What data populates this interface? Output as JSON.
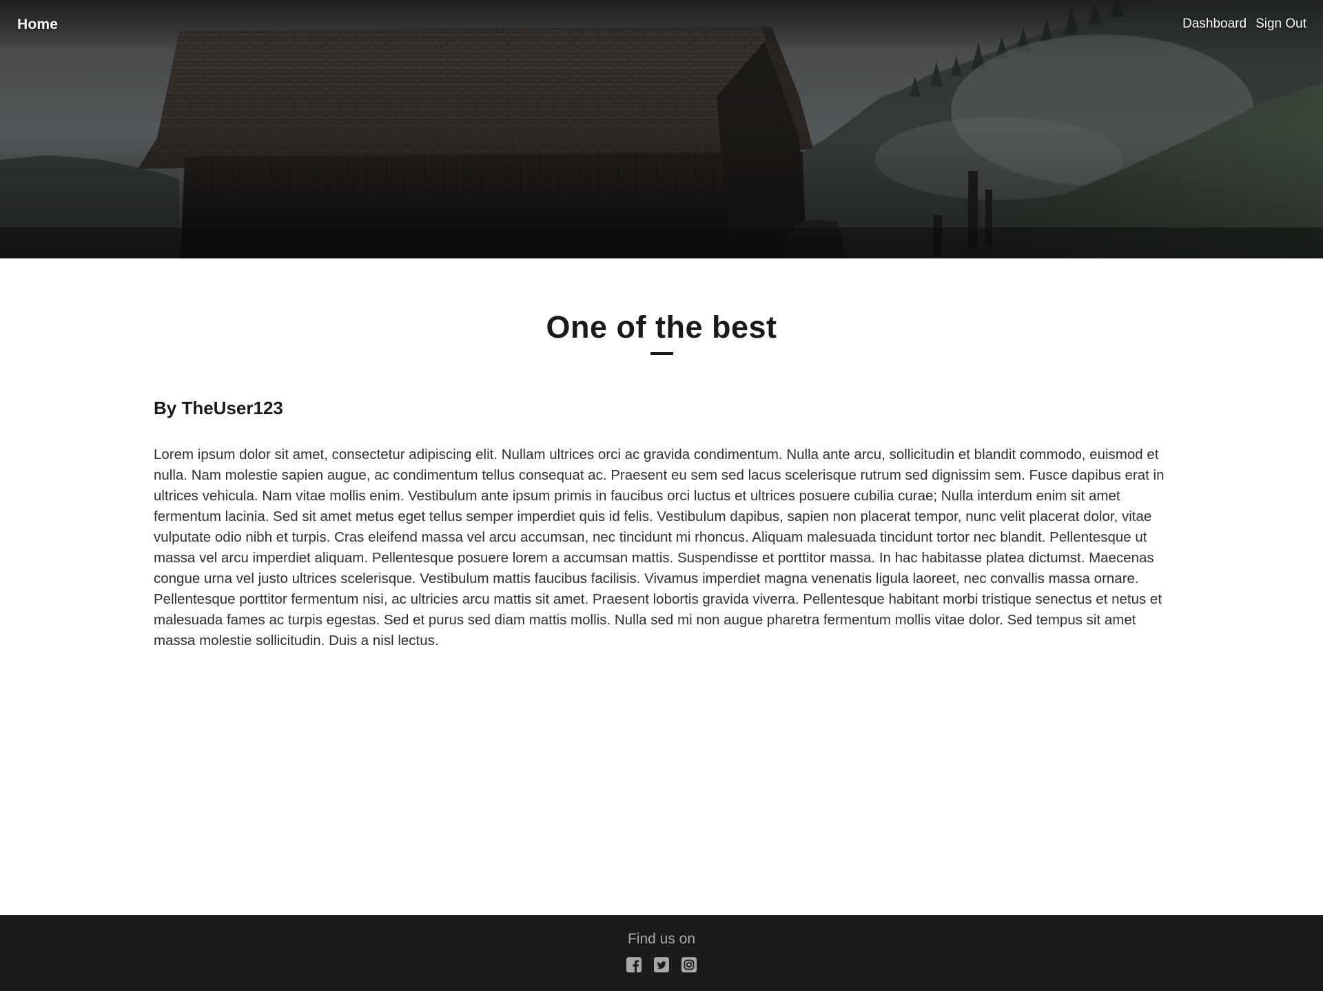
{
  "nav": {
    "home_label": "Home",
    "links": [
      {
        "label": "Dashboard"
      },
      {
        "label": "Sign Out"
      }
    ]
  },
  "hero": {
    "image": "barn-in-fog-icon"
  },
  "post": {
    "title": "One of the best",
    "author": "By TheUser123",
    "body": "Lorem ipsum dolor sit amet, consectetur adipiscing elit. Nullam ultrices orci ac gravida condimentum. Nulla ante arcu, sollicitudin et blandit commodo, euismod et nulla. Nam molestie sapien augue, ac condimentum tellus consequat ac. Praesent eu sem sed lacus scelerisque rutrum sed dignissim sem. Fusce dapibus erat in ultrices vehicula. Nam vitae mollis enim. Vestibulum ante ipsum primis in faucibus orci luctus et ultrices posuere cubilia curae; Nulla interdum enim sit amet fermentum lacinia. Sed sit amet metus eget tellus semper imperdiet quis id felis. Vestibulum dapibus, sapien non placerat tempor, nunc velit placerat dolor, vitae vulputate odio nibh et turpis. Cras eleifend massa vel arcu accumsan, nec tincidunt mi rhoncus. Aliquam malesuada tincidunt tortor nec blandit. Pellentesque ut massa vel arcu imperdiet aliquam. Pellentesque posuere lorem a accumsan mattis. Suspendisse et porttitor massa. In hac habitasse platea dictumst. Maecenas congue urna vel justo ultrices scelerisque. Vestibulum mattis faucibus facilisis. Vivamus imperdiet magna venenatis ligula laoreet, nec convallis massa ornare. Pellentesque porttitor fermentum nisi, ac ultricies arcu mattis sit amet. Praesent lobortis gravida viverra. Pellentesque habitant morbi tristique senectus et netus et malesuada fames ac turpis egestas. Sed et purus sed diam mattis mollis. Nulla sed mi non augue pharetra fermentum mollis vitae dolor. Sed tempus sit amet massa molestie sollicitudin. Duis a nisl lectus."
  },
  "footer": {
    "label": "Find us on",
    "social": [
      {
        "icon": "facebook-icon"
      },
      {
        "icon": "twitter-icon"
      },
      {
        "icon": "instagram-icon"
      }
    ]
  },
  "colors": {
    "footer_bg": "#1b1b1b",
    "footer_text": "#a9a9a9",
    "heading": "#1a1a1a",
    "body_text": "#2f2f2f",
    "nav_text": "#ffffff"
  }
}
